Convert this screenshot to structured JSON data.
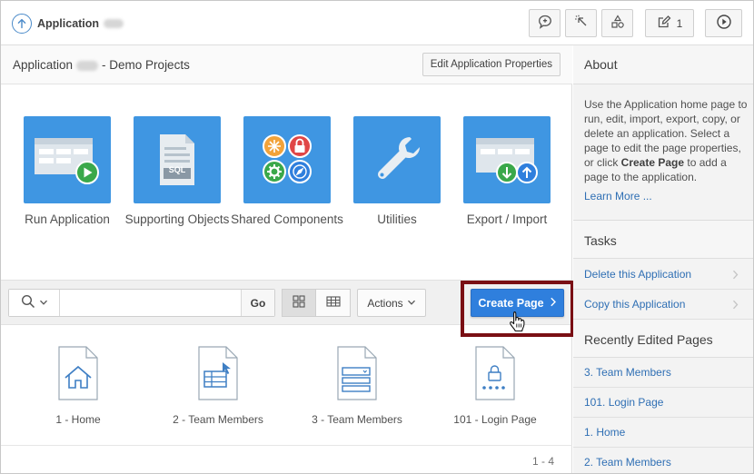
{
  "header": {
    "app_label": "Application",
    "toolbar_count": "1"
  },
  "region": {
    "title_prefix": "Application",
    "title_suffix": "- Demo Projects",
    "edit_button": "Edit Application Properties"
  },
  "tiles": [
    {
      "label": "Run Application",
      "icon": "run-application-icon"
    },
    {
      "label": "Supporting Objects",
      "icon": "sql-document-icon"
    },
    {
      "label": "Shared Components",
      "icon": "shared-components-icon"
    },
    {
      "label": "Utilities",
      "icon": "wrench-icon"
    },
    {
      "label": "Export / Import",
      "icon": "export-import-icon"
    }
  ],
  "tile_sql_text": "SQL",
  "toolbar": {
    "search_placeholder": "",
    "go_label": "Go",
    "actions_label": "Actions",
    "create_label": "Create Page"
  },
  "pages": [
    {
      "label": "1 - Home",
      "icon": "home-page-icon"
    },
    {
      "label": "2 - Team Members",
      "icon": "report-page-icon"
    },
    {
      "label": "3 - Team Members",
      "icon": "form-page-icon"
    },
    {
      "label": "101 - Login Page",
      "icon": "login-page-icon"
    }
  ],
  "pager": "1 - 4",
  "sidebar": {
    "about_title": "About",
    "about_text_1": "Use the Application home page to run, edit, import, export, copy, or delete an application. Select a page to edit the page properties, or click ",
    "about_bold": "Create Page",
    "about_text_2": " to add a page to the application.",
    "learn_more": "Learn More ...",
    "tasks_title": "Tasks",
    "tasks": [
      "Delete this Application",
      "Copy this Application"
    ],
    "recent_title": "Recently Edited Pages",
    "recent": [
      "3. Team Members",
      "101. Login Page",
      "1. Home",
      "2. Team Members"
    ]
  },
  "colors": {
    "tile_blue": "#3f96e2",
    "create_blue": "#2f7fdd",
    "highlight": "#7a0f14",
    "link": "#2f6fb4"
  }
}
